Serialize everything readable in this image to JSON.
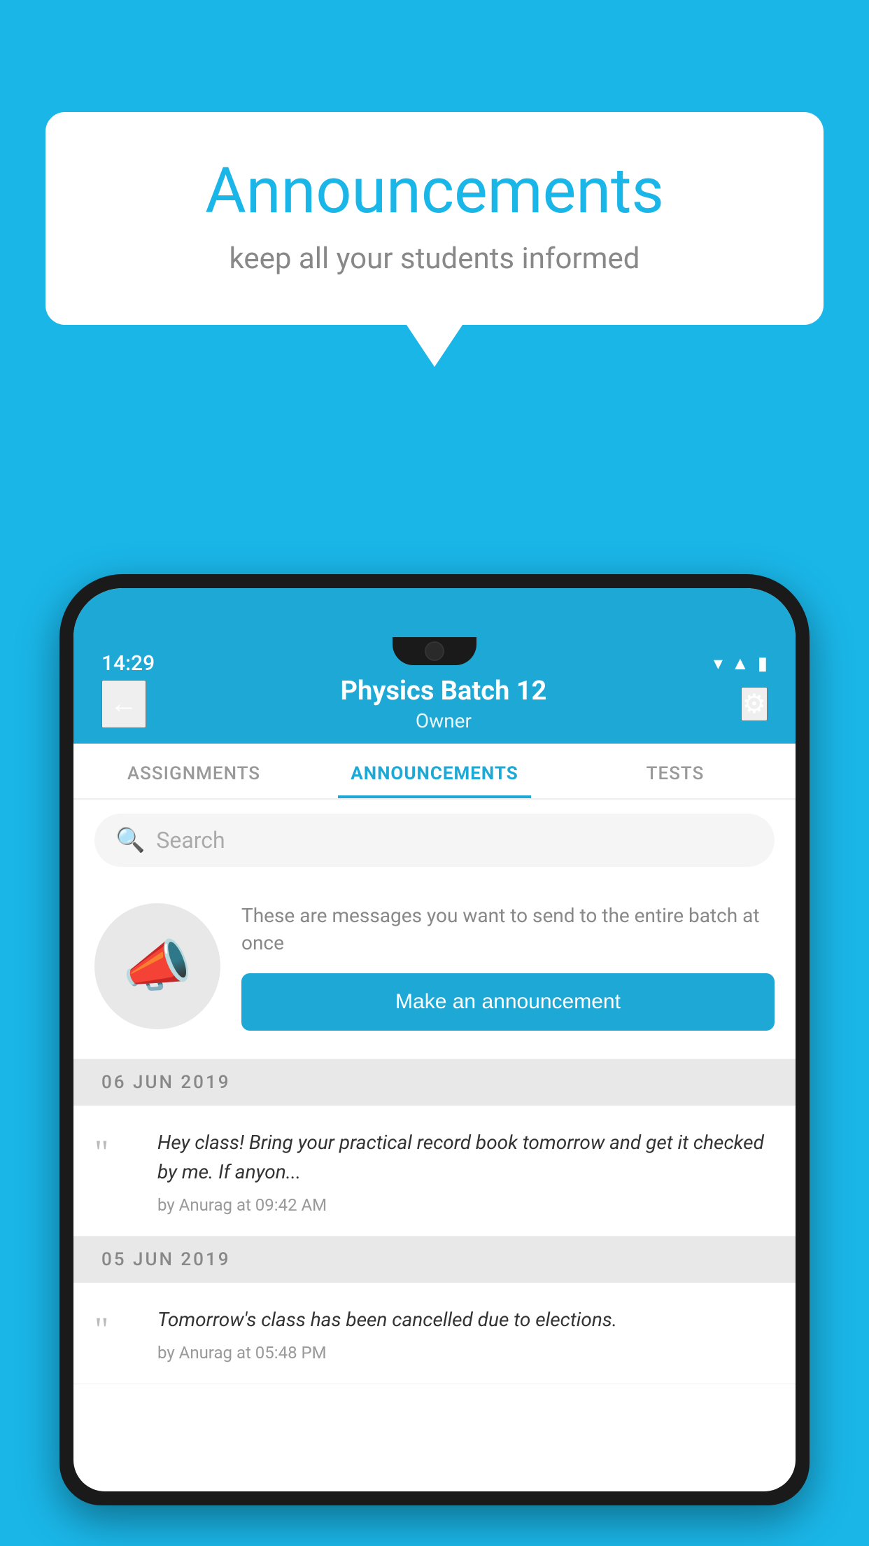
{
  "colors": {
    "bg": "#1ab6e8",
    "headerBg": "#1da8d5",
    "white": "#ffffff",
    "textGray": "#888888",
    "tabActive": "#1da8d5",
    "btnBg": "#1da8d5"
  },
  "speechBubble": {
    "title": "Announcements",
    "subtitle": "keep all your students informed"
  },
  "statusBar": {
    "time": "14:29"
  },
  "appHeader": {
    "batchName": "Physics Batch 12",
    "role": "Owner",
    "backLabel": "←",
    "settingsLabel": "⚙"
  },
  "tabs": [
    {
      "label": "ASSIGNMENTS",
      "active": false
    },
    {
      "label": "ANNOUNCEMENTS",
      "active": true
    },
    {
      "label": "TESTS",
      "active": false
    }
  ],
  "search": {
    "placeholder": "Search"
  },
  "announcementPrompt": {
    "description": "These are messages you want to send to the entire batch at once",
    "buttonLabel": "Make an announcement"
  },
  "announcements": [
    {
      "date": "06  JUN  2019",
      "text": "Hey class! Bring your practical record book tomorrow and get it checked by me. If anyon...",
      "meta": "by Anurag at 09:42 AM"
    },
    {
      "date": "05  JUN  2019",
      "text": "Tomorrow's class has been cancelled due to elections.",
      "meta": "by Anurag at 05:48 PM"
    }
  ]
}
